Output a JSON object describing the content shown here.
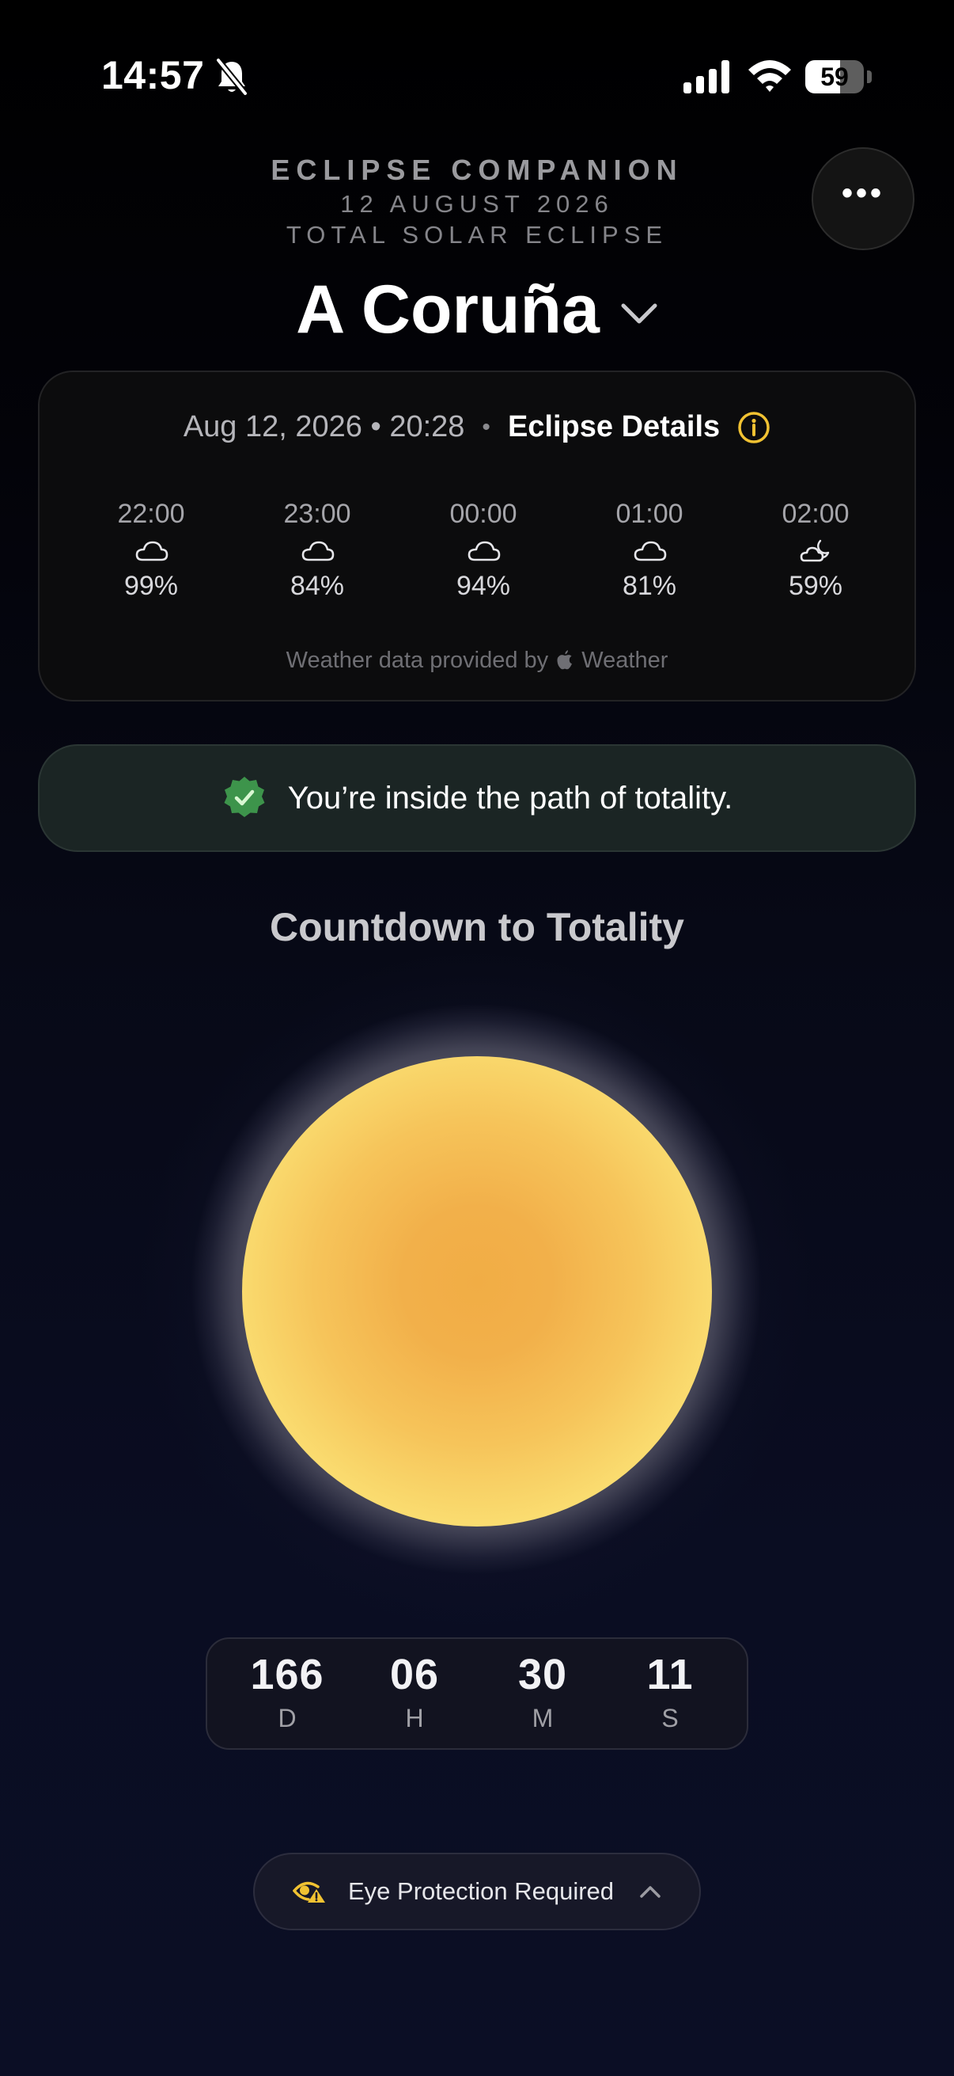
{
  "status_bar": {
    "time": "14:57",
    "battery_level": "59",
    "battery_fraction": 0.59,
    "icons": [
      "bell-slash-icon",
      "cellular-signal-icon",
      "wifi-icon",
      "battery-icon"
    ]
  },
  "header": {
    "app_title": "ECLIPSE COMPANION",
    "eclipse_date": "12 AUGUST 2026",
    "eclipse_type": "TOTAL SOLAR ECLIPSE",
    "location": "A Coruña",
    "more_icon": "ellipsis-icon"
  },
  "weather": {
    "datetime": "Aug 12, 2026 • 20:28",
    "separator": "•",
    "details_link": "Eclipse Details",
    "forecast": [
      {
        "time": "22:00",
        "icon": "cloud-icon",
        "value": "99%"
      },
      {
        "time": "23:00",
        "icon": "cloud-icon",
        "value": "84%"
      },
      {
        "time": "00:00",
        "icon": "cloud-icon",
        "value": "94%"
      },
      {
        "time": "01:00",
        "icon": "cloud-icon",
        "value": "81%"
      },
      {
        "time": "02:00",
        "icon": "cloud-moon-icon",
        "value": "59%"
      }
    ],
    "credit_prefix": "Weather data provided by",
    "credit_brand": "Weather"
  },
  "totality_banner": {
    "text": "You’re inside the path of totality."
  },
  "countdown": {
    "title": "Countdown to Totality",
    "units": [
      {
        "value": "166",
        "label": "D"
      },
      {
        "value": "06",
        "label": "H"
      },
      {
        "value": "30",
        "label": "M"
      },
      {
        "value": "11",
        "label": "S"
      }
    ]
  },
  "eye_protection": {
    "label": "Eye Protection Required"
  },
  "colors": {
    "accent_yellow": "#f1c232",
    "success_green": "#3f9a4e",
    "sun_core": "#f1ad45",
    "sun_edge": "#fdec7e"
  }
}
